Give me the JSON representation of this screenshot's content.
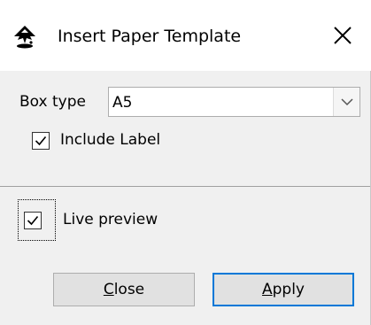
{
  "window": {
    "title": "Insert Paper Template",
    "app_icon": "inkscape-icon",
    "close_icon": "close-icon"
  },
  "form": {
    "box_type_label": "Box type",
    "box_type_value": "A5",
    "include_label_text": "Include Label",
    "include_label_checked": true
  },
  "live_preview": {
    "label": "Live preview",
    "checked": true
  },
  "buttons": {
    "close_mnemonic": "C",
    "close_rest": "lose",
    "apply_mnemonic": "A",
    "apply_rest": "pply"
  },
  "colors": {
    "accent": "#0078d7",
    "button_bg": "#e1e1e1",
    "dialog_bg": "#f0f0f0"
  }
}
